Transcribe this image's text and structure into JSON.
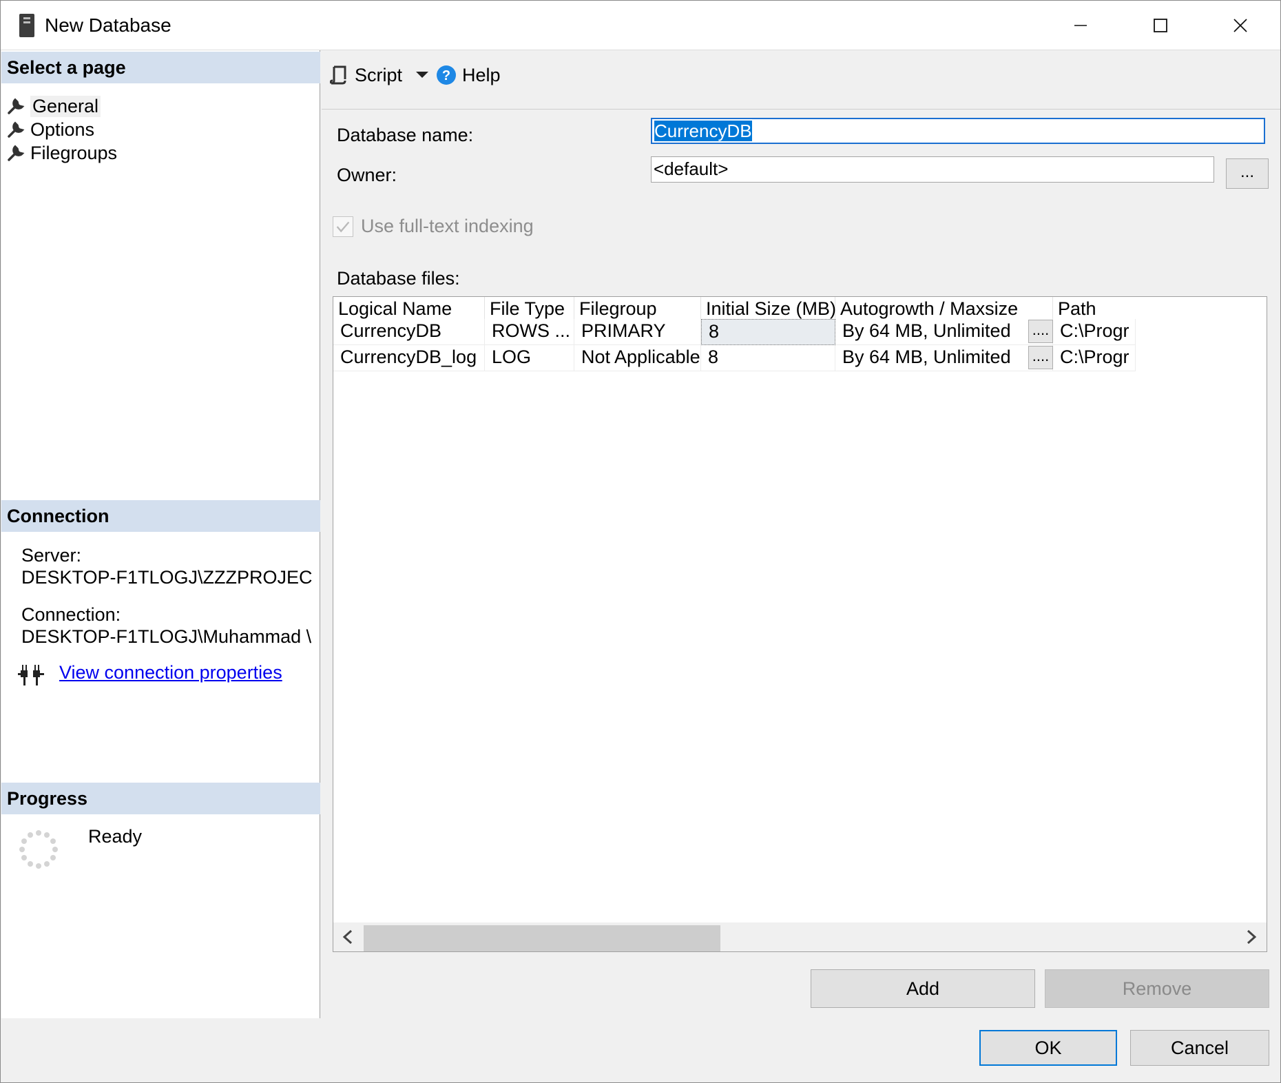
{
  "window": {
    "title": "New Database",
    "controls": {
      "minimize": "—",
      "maximize": "☐",
      "close": "✕"
    }
  },
  "left_panel": {
    "select_page_header": "Select a page",
    "pages": [
      {
        "label": "General",
        "selected": true
      },
      {
        "label": "Options",
        "selected": false
      },
      {
        "label": "Filegroups",
        "selected": false
      }
    ],
    "connection_header": "Connection",
    "server_label": "Server:",
    "server_value": "DESKTOP-F1TLOGJ\\ZZZPROJEC",
    "connection_label": "Connection:",
    "connection_value": "DESKTOP-F1TLOGJ\\Muhammad \\",
    "view_connection_link": "View connection properties",
    "progress_header": "Progress",
    "progress_status": "Ready"
  },
  "toolbar": {
    "script_label": "Script",
    "help_label": "Help"
  },
  "general": {
    "database_name_label": "Database name:",
    "database_name_value": "CurrencyDB",
    "owner_label": "Owner:",
    "owner_value": "<default>",
    "owner_browse_label": "...",
    "fulltext_label": "Use full-text indexing",
    "fulltext_checked": true,
    "database_files_label": "Database files:"
  },
  "files_grid": {
    "columns": [
      "Logical Name",
      "File Type",
      "Filegroup",
      "Initial Size (MB)",
      "Autogrowth / Maxsize",
      "Path"
    ],
    "rows": [
      {
        "logical_name": "CurrencyDB",
        "file_type": "ROWS ...",
        "filegroup": "PRIMARY",
        "initial_size": "8",
        "autogrowth": "By 64 MB, Unlimited",
        "browse": "....",
        "path": "C:\\Progr"
      },
      {
        "logical_name": "CurrencyDB_log",
        "file_type": "LOG",
        "filegroup": "Not Applicable",
        "initial_size": "8",
        "autogrowth": "By 64 MB, Unlimited",
        "browse": "....",
        "path": "C:\\Progr"
      }
    ],
    "scroll_left": "<",
    "scroll_right": ">"
  },
  "grid_buttons": {
    "add_label": "Add",
    "remove_label": "Remove"
  },
  "dialog_buttons": {
    "ok_label": "OK",
    "cancel_label": "Cancel"
  },
  "colors": {
    "section_header": "#d3dfee",
    "selection": "#0078d7",
    "link": "#0000ee",
    "dialog_bg": "#f0f0f0"
  }
}
